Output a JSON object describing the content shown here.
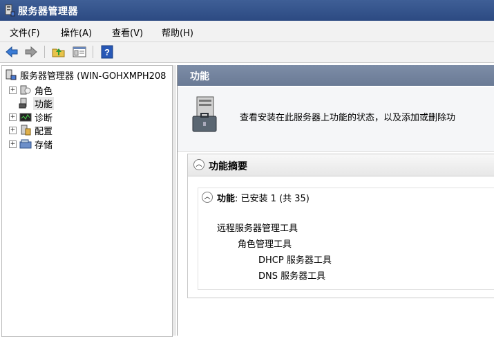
{
  "window": {
    "title": "服务器管理器"
  },
  "menu": [
    "文件(F)",
    "操作(A)",
    "查看(V)",
    "帮助(H)"
  ],
  "toolbar": {
    "icons": [
      "back-icon",
      "forward-icon",
      "up-folder-icon",
      "show-hide-tree-icon",
      "help-icon"
    ]
  },
  "tree": {
    "root": "服务器管理器 (WIN-GOHXMPH208",
    "items": [
      {
        "label": "角色",
        "icon": "roles-icon",
        "expandable": true
      },
      {
        "label": "功能",
        "icon": "features-icon",
        "expandable": false,
        "selected": true
      },
      {
        "label": "诊断",
        "icon": "diagnostics-icon",
        "expandable": true
      },
      {
        "label": "配置",
        "icon": "configuration-icon",
        "expandable": true
      },
      {
        "label": "存储",
        "icon": "storage-icon",
        "expandable": true
      }
    ]
  },
  "main": {
    "header": "功能",
    "description": "查看安装在此服务器上功能的状态，以及添加或删除功",
    "section_title": "功能摘要",
    "features_label": "功能",
    "features_status": ": 已安装 1 (共 35)",
    "installed_tree": [
      {
        "label": "远程服务器管理工具",
        "level": 0
      },
      {
        "label": "角色管理工具",
        "level": 1
      },
      {
        "label": "DHCP 服务器工具",
        "level": 2
      },
      {
        "label": "DNS 服务器工具",
        "level": 2
      }
    ]
  }
}
